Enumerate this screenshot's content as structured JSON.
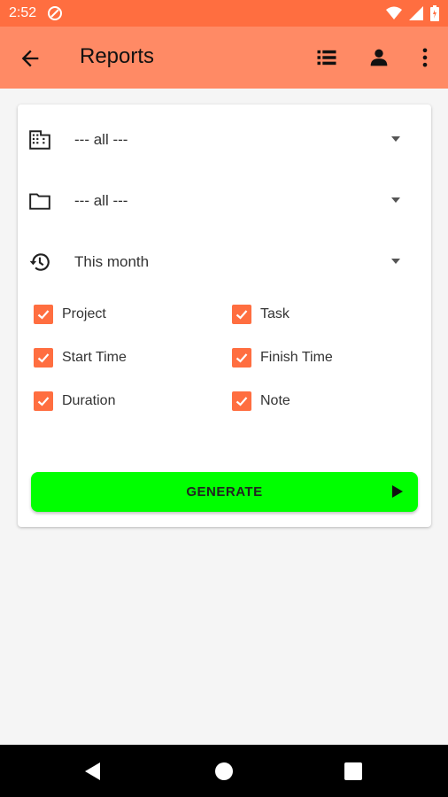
{
  "status_bar": {
    "time": "2:52",
    "icons": [
      "notification-icon",
      "wifi-icon",
      "signal-icon",
      "battery-icon"
    ]
  },
  "app_bar": {
    "title": "Reports",
    "icons": [
      "back-arrow-icon",
      "list-icon",
      "person-icon",
      "more-vert-icon"
    ]
  },
  "filters": {
    "company": "--- all ---",
    "project": "--- all ---",
    "period": "This month"
  },
  "columns": [
    {
      "label": "Project",
      "checked": true
    },
    {
      "label": "Task",
      "checked": true
    },
    {
      "label": "Start Time",
      "checked": true
    },
    {
      "label": "Finish Time",
      "checked": true
    },
    {
      "label": "Duration",
      "checked": true
    },
    {
      "label": "Note",
      "checked": true
    }
  ],
  "generate_button": {
    "label": "GENERATE"
  },
  "colors": {
    "status_bar": "#ff6e40",
    "app_bar": "#ff8a65",
    "checkbox": "#ff6e40",
    "generate": "#00ff00"
  }
}
